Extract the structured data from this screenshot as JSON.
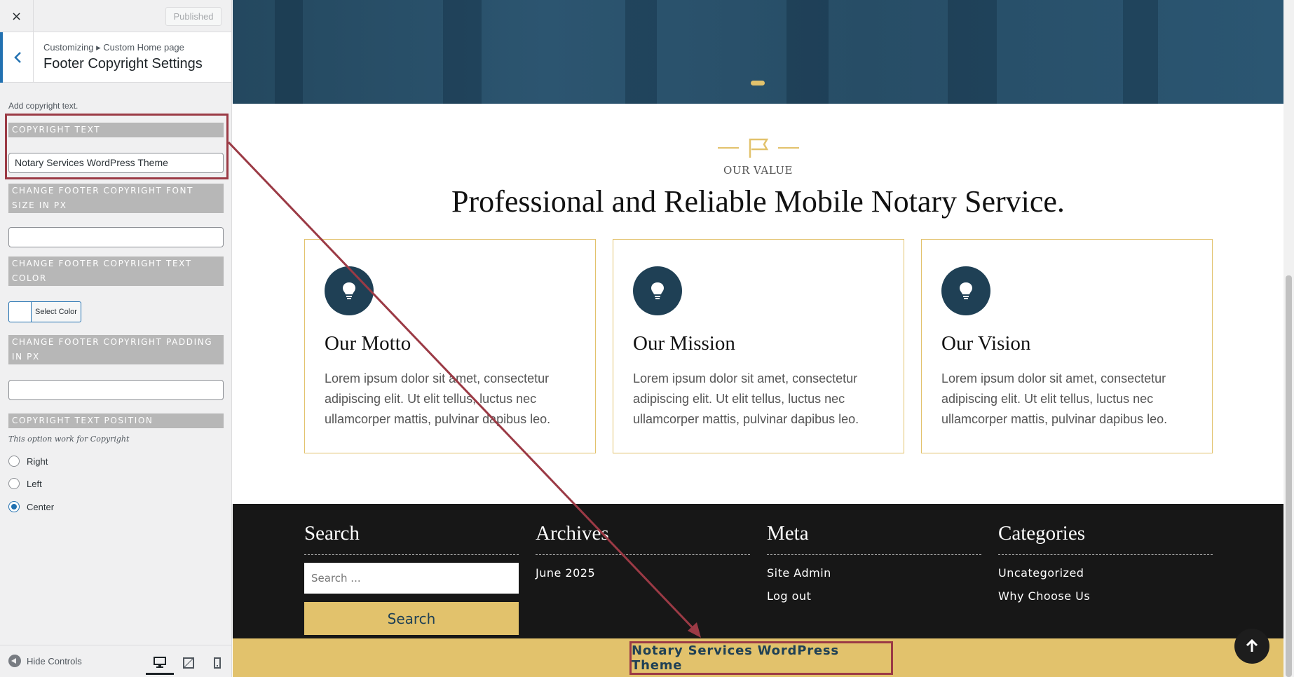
{
  "customizer": {
    "close_label": "×",
    "published_label": "Published",
    "breadcrumb": "Customizing ▸ Custom Home page",
    "section_title": "Footer Copyright Settings",
    "description": "Add copyright text.",
    "controls": {
      "copyright_text_label": "COPYRIGHT TEXT",
      "copyright_text_value": "Notary Services WordPress Theme",
      "font_size_label": "CHANGE FOOTER COPYRIGHT FONT SIZE IN PX",
      "font_size_value": "",
      "text_color_label": "CHANGE FOOTER COPYRIGHT TEXT COLOR",
      "select_color_label": "Select Color",
      "padding_label": "CHANGE FOOTER COPYRIGHT PADDING IN PX",
      "padding_value": "",
      "position_label": "COPYRIGHT TEXT POSITION",
      "position_note": "This option work for Copyright",
      "position_options": [
        "Right",
        "Left",
        "Center"
      ],
      "position_selected": "Center"
    },
    "hide_controls_label": "Hide Controls",
    "devices": [
      "desktop-icon",
      "tablet-icon",
      "mobile-icon"
    ],
    "active_device": "desktop"
  },
  "preview": {
    "value_subtitle": "OUR VALUE",
    "value_title": "Professional and Reliable Mobile Notary Service.",
    "cards": [
      {
        "title": "Our Motto",
        "text": "Lorem ipsum dolor sit amet, consectetur adipiscing elit. Ut elit tellus, luctus nec ullamcorper mattis, pulvinar dapibus leo.",
        "icon": "lightbulb-icon"
      },
      {
        "title": "Our Mission",
        "text": "Lorem ipsum dolor sit amet, consectetur adipiscing elit. Ut elit tellus, luctus nec ullamcorper mattis, pulvinar dapibus leo.",
        "icon": "lightbulb-icon"
      },
      {
        "title": "Our Vision",
        "text": "Lorem ipsum dolor sit amet, consectetur adipiscing elit. Ut elit tellus, luctus nec ullamcorper mattis, pulvinar dapibus leo.",
        "icon": "lightbulb-icon"
      }
    ],
    "widgets": {
      "search": {
        "title": "Search",
        "placeholder": "Search ...",
        "button": "Search"
      },
      "archives": {
        "title": "Archives",
        "links": [
          "June 2025"
        ]
      },
      "meta": {
        "title": "Meta",
        "links": [
          "Site Admin",
          "Log out"
        ]
      },
      "categories": {
        "title": "Categories",
        "links": [
          "Uncategorized",
          "Why Choose Us"
        ]
      }
    },
    "copyright": "Notary Services WordPress Theme"
  },
  "colors": {
    "accent_gold": "#e2c26c",
    "navy": "#1f4055",
    "annotation_red": "#9b3a45",
    "wp_blue": "#2271b1"
  }
}
